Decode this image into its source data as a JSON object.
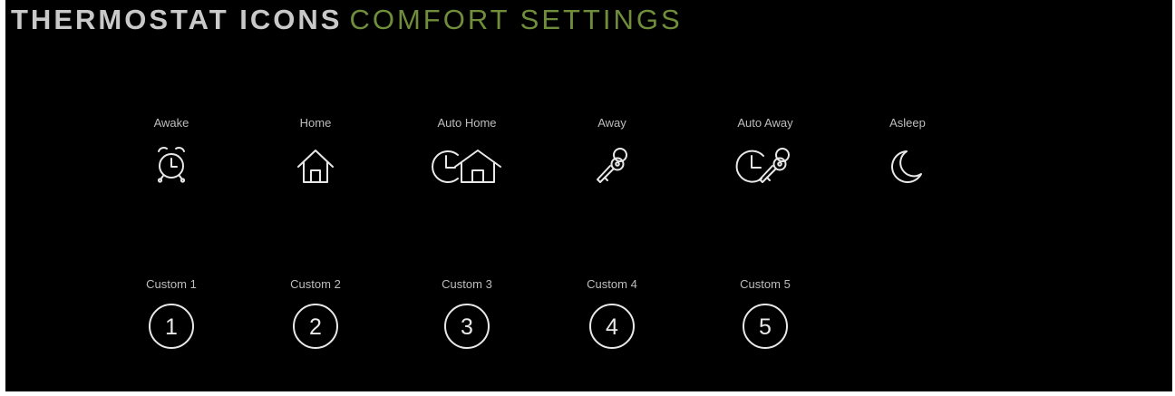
{
  "header": {
    "title_bold": "THERMOSTAT ICONS",
    "title_light": "COMFORT SETTINGS"
  },
  "colors": {
    "background": "#000000",
    "title_bold": "#c9c9c9",
    "title_light": "#6f8d3a",
    "label": "#bdbdbd",
    "icon_stroke": "#e8e8e8"
  },
  "settings": [
    {
      "label": "Awake",
      "icon": "alarm-clock-icon"
    },
    {
      "label": "Home",
      "icon": "house-icon"
    },
    {
      "label": "Auto Home",
      "icon": "clock-house-icon"
    },
    {
      "label": "Away",
      "icon": "key-icon"
    },
    {
      "label": "Auto Away",
      "icon": "clock-key-icon"
    },
    {
      "label": "Asleep",
      "icon": "moon-icon"
    }
  ],
  "custom": [
    {
      "label": "Custom 1",
      "number": "1"
    },
    {
      "label": "Custom 2",
      "number": "2"
    },
    {
      "label": "Custom 3",
      "number": "3"
    },
    {
      "label": "Custom 4",
      "number": "4"
    },
    {
      "label": "Custom 5",
      "number": "5"
    }
  ]
}
